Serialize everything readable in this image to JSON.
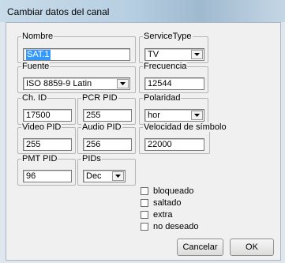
{
  "window": {
    "title": "Cambiar datos del canal"
  },
  "fields": {
    "nombre": {
      "label": "Nombre",
      "value": "SAT.1"
    },
    "service_type": {
      "label": "ServiceType",
      "value": "TV"
    },
    "fuente": {
      "label": "Fuente",
      "value": "ISO 8859-9 Latin"
    },
    "frecuencia": {
      "label": "Frecuencia",
      "value": "12544"
    },
    "ch_id": {
      "label": "Ch. ID",
      "value": "17500"
    },
    "pcr_pid": {
      "label": "PCR PID",
      "value": "255"
    },
    "polaridad": {
      "label": "Polaridad",
      "value": "hor"
    },
    "video_pid": {
      "label": "Video PID",
      "value": "255"
    },
    "audio_pid": {
      "label": "Audio PID",
      "value": "256"
    },
    "velocidad": {
      "label": "Velocidad de símbolo",
      "value": "22000"
    },
    "pmt_pid": {
      "label": "PMT PID",
      "value": "96"
    },
    "pids": {
      "label": "PIDs",
      "value": "Dec"
    }
  },
  "checkboxes": [
    {
      "label": "bloqueado",
      "checked": false
    },
    {
      "label": "saltado",
      "checked": false
    },
    {
      "label": "extra",
      "checked": false
    },
    {
      "label": "no deseado",
      "checked": false
    }
  ],
  "buttons": {
    "cancel": "Cancelar",
    "ok": "OK"
  },
  "icons": {
    "dropdown": "chevron-down-icon"
  },
  "colors": {
    "selection": "#3399ff",
    "titlebar": "#b7cfe2"
  }
}
